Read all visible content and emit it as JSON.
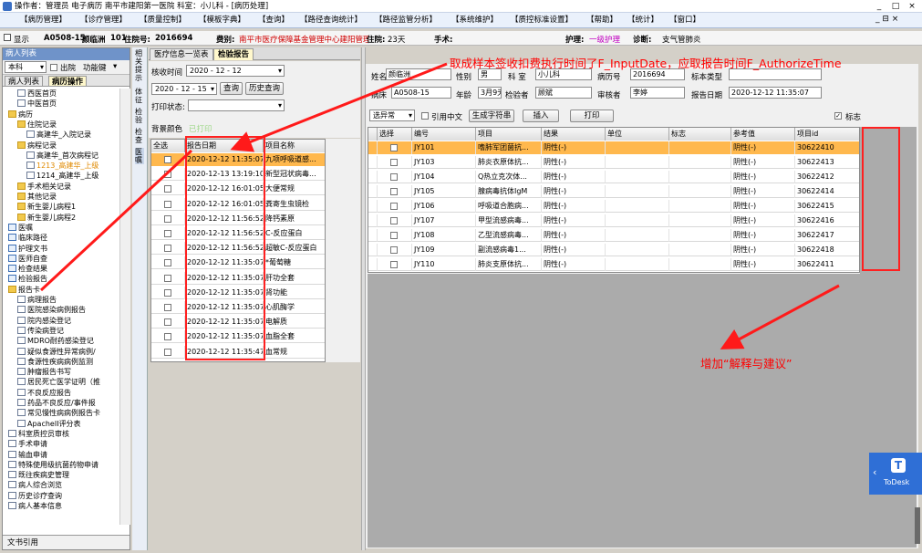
{
  "window": {
    "title": "操作者：管理员 电子病历  南平市建阳第一医院  科室：小儿科 - [病历处理]",
    "controls": [
      "_",
      "□",
      "×"
    ]
  },
  "menubar": {
    "items": [
      "【病历管理】",
      "【诊疗管理】",
      "【质量控制】",
      "【模板字典】",
      "【查询】",
      "【路径查询统计】",
      "【路径监管分析】",
      "【系统维护】",
      "【质控标准设置】",
      "【帮助】",
      "【统计】",
      "【窗口】"
    ],
    "dropdown": "⌄",
    "right_controls": "_  ⊟  ×"
  },
  "infobar": {
    "show_label": "显示",
    "bed": "A0508-15",
    "name": "颜临洲",
    "bed_no": "101",
    "admission_label": "住院号:",
    "admission_no": "2016694",
    "category_label": "费别:",
    "category": "南平市医疗保障基金管理中心建阳管理",
    "stay_label": "住院:",
    "stay": "23天",
    "surgery_label": "手术:",
    "nursing_label": "护理:",
    "nursing": "一级护理",
    "diagnosis_label": "诊断:",
    "diagnosis": "支气管肺炎"
  },
  "left": {
    "header": "病人列表",
    "dept": "本科",
    "discharged_label": "出院",
    "function_key_label": "功能键",
    "tabs": [
      "病人列表",
      "病历操作"
    ],
    "tree": [
      {
        "label": "西医首页",
        "level": 1,
        "icon": "doc"
      },
      {
        "label": "中医首页",
        "level": 1,
        "icon": "doc"
      },
      {
        "label": "病历",
        "level": 0,
        "icon": "folder"
      },
      {
        "label": "住院记录",
        "level": 1,
        "icon": "folder"
      },
      {
        "label": "高建华_入院记录",
        "level": 2,
        "icon": "doc"
      },
      {
        "label": "病程记录",
        "level": 1,
        "icon": "folder"
      },
      {
        "label": "高建华_首次病程记",
        "level": 2,
        "icon": "doc"
      },
      {
        "label": "1213_高建华_上级",
        "level": 2,
        "icon": "doc",
        "highlight": true
      },
      {
        "label": "1214_高建华_上级",
        "level": 2,
        "icon": "doc"
      },
      {
        "label": "手术相关记录",
        "level": 1,
        "icon": "folder"
      },
      {
        "label": "其他记录",
        "level": 1,
        "icon": "folder"
      },
      {
        "label": "新生婴儿病程1",
        "level": 1,
        "icon": "folder"
      },
      {
        "label": "新生婴儿病程2",
        "level": 1,
        "icon": "folder"
      },
      {
        "label": "医嘱",
        "level": 0,
        "icon": "check"
      },
      {
        "label": "临床路径",
        "level": 0,
        "icon": "check"
      },
      {
        "label": "护理文书",
        "level": 0,
        "icon": "check"
      },
      {
        "label": "医师自查",
        "level": 0,
        "icon": "check"
      },
      {
        "label": "检查结果",
        "level": 0,
        "icon": "check"
      },
      {
        "label": "检验报告",
        "level": 0,
        "icon": "check"
      },
      {
        "label": "报告卡",
        "level": 0,
        "icon": "folder"
      },
      {
        "label": "病理报告",
        "level": 1,
        "icon": "doc"
      },
      {
        "label": "医院感染病例报告",
        "level": 1,
        "icon": "doc"
      },
      {
        "label": "院内感染登记",
        "level": 1,
        "icon": "doc"
      },
      {
        "label": "传染病登记",
        "level": 1,
        "icon": "doc"
      },
      {
        "label": "MDRO耐药感染登记",
        "level": 1,
        "icon": "doc"
      },
      {
        "label": "疑似食源性异常病例/",
        "level": 1,
        "icon": "doc"
      },
      {
        "label": "食源性疾病病例监测",
        "level": 1,
        "icon": "doc"
      },
      {
        "label": "肿瘤报告书写",
        "level": 1,
        "icon": "doc"
      },
      {
        "label": "居民死亡医学证明（推",
        "level": 1,
        "icon": "doc"
      },
      {
        "label": "不良反应报告",
        "level": 1,
        "icon": "doc"
      },
      {
        "label": "药品不良反应/事件报",
        "level": 1,
        "icon": "doc"
      },
      {
        "label": "常见慢性病病例报告卡",
        "level": 1,
        "icon": "doc"
      },
      {
        "label": "ApacheII评分表",
        "level": 1,
        "icon": "doc"
      },
      {
        "label": "科室质控员审核",
        "level": 0,
        "icon": "doc"
      },
      {
        "label": "手术申请",
        "level": 0,
        "icon": "doc"
      },
      {
        "label": "输血申请",
        "level": 0,
        "icon": "doc"
      },
      {
        "label": "特殊使用级抗菌药物申请",
        "level": 0,
        "icon": "doc"
      },
      {
        "label": "既往疾病史管理",
        "level": 0,
        "icon": "doc"
      },
      {
        "label": "病人综合浏览",
        "level": 0,
        "icon": "doc"
      },
      {
        "label": "历史诊疗查询",
        "level": 0,
        "icon": "doc"
      },
      {
        "label": "病人基本信息",
        "level": 0,
        "icon": "doc"
      }
    ],
    "footer": "文书引用"
  },
  "vstrip": [
    "相关提示",
    "体征",
    "检验",
    "检查",
    "医嘱"
  ],
  "middle": {
    "tabs": [
      "医疗信息一览表",
      "检验报告"
    ],
    "check_time_label": "核收时间",
    "date_from": "2020 - 12 - 12",
    "date_to": "2020 - 12 - 15",
    "query_btn": "查询",
    "history_btn": "历史查询",
    "print_status_label": "打印状态:",
    "print_status": "",
    "bg_color_label": "背景颜色",
    "printed_label": "已打印",
    "columns": [
      "全选",
      "报告日期",
      "项目名称"
    ],
    "rows": [
      {
        "date": "2020-12-12 11:35:07",
        "name": "九项呼吸道感..."
      },
      {
        "date": "2020-12-13 13:19:10",
        "name": "新型冠状病毒..."
      },
      {
        "date": "2020-12-12 16:01:05",
        "name": "大便常规"
      },
      {
        "date": "2020-12-12 16:01:05",
        "name": "粪寄生虫镜检"
      },
      {
        "date": "2020-12-12 11:56:52",
        "name": "降钙素原"
      },
      {
        "date": "2020-12-12 11:56:52",
        "name": "C-反应蛋白"
      },
      {
        "date": "2020-12-12 11:56:52",
        "name": "超敏C-反应蛋白"
      },
      {
        "date": "2020-12-12 11:35:07",
        "name": "*葡萄糖"
      },
      {
        "date": "2020-12-12 11:35:07",
        "name": "肝功全套"
      },
      {
        "date": "2020-12-12 11:35:07",
        "name": "肾功能"
      },
      {
        "date": "2020-12-12 11:35:07",
        "name": "心肌酶学"
      },
      {
        "date": "2020-12-12 11:35:07",
        "name": "电解质"
      },
      {
        "date": "2020-12-12 11:35:07",
        "name": "血脂全套"
      },
      {
        "date": "2020-12-12 11:35:47",
        "name": "血常规"
      }
    ]
  },
  "right": {
    "name_label": "姓名",
    "name": "颜临洲",
    "sex_label": "性别",
    "sex": "男",
    "dept_label": "科  室",
    "dept": "小儿科",
    "mrn_label": "病历号",
    "mrn": "2016694",
    "specimen_label": "标本类型",
    "specimen": "",
    "bed_label": "病床",
    "bed": "A0508-15",
    "age_label": "年龄",
    "age": "3月9天",
    "inspector_label": "检验者",
    "inspector": "顾斌",
    "reviewer_label": "审核者",
    "reviewer": "李婷",
    "report_date_label": "报告日期",
    "report_date": "2020-12-12 11:35:07",
    "filter": "选异常",
    "cite_cn_label": "引用中文",
    "gen_char_btn": "生成字符串",
    "insert_btn": "插入",
    "print_btn": "打印",
    "flag_label": "标志",
    "columns": [
      "选择",
      "编号",
      "项目",
      "结果",
      "单位",
      "标志",
      "参考值",
      "项目id"
    ],
    "rows": [
      {
        "code": "JY101",
        "item": "嗜肺军团菌抗...",
        "result": "阴性(-)",
        "ref": "阴性(-)",
        "id": "30622410"
      },
      {
        "code": "JY103",
        "item": "肺炎衣原体抗...",
        "result": "阴性(-)",
        "ref": "阴性(-)",
        "id": "30622413"
      },
      {
        "code": "JY104",
        "item": "Q热立克次体...",
        "result": "阴性(-)",
        "ref": "阴性(-)",
        "id": "30622412"
      },
      {
        "code": "JY105",
        "item": "腺病毒抗体IgM",
        "result": "阴性(-)",
        "ref": "阴性(-)",
        "id": "30622414"
      },
      {
        "code": "JY106",
        "item": "呼吸道合胞病...",
        "result": "阴性(-)",
        "ref": "阴性(-)",
        "id": "30622415"
      },
      {
        "code": "JY107",
        "item": "甲型流感病毒...",
        "result": "阴性(-)",
        "ref": "阴性(-)",
        "id": "30622416"
      },
      {
        "code": "JY108",
        "item": "乙型流感病毒...",
        "result": "阴性(-)",
        "ref": "阴性(-)",
        "id": "30622417"
      },
      {
        "code": "JY109",
        "item": "副流感病毒1...",
        "result": "阴性(-)",
        "ref": "阴性(-)",
        "id": "30622418"
      },
      {
        "code": "JY110",
        "item": "肺炎支原体抗...",
        "result": "阴性(-)",
        "ref": "阴性(-)",
        "id": "30622411"
      }
    ]
  },
  "annotations": {
    "top": "取成样本签收扣费执行时间了F_InputDate，应取报告时间F_AuthorizeTime",
    "right": "增加“解释与建议”"
  },
  "todesk": {
    "label": "ToDesk"
  },
  "colors": {
    "annotation": "#ff0000",
    "selected_row": "#ffb84d",
    "tab_active": "#fff8cc",
    "header_blue": "#6f93c9"
  }
}
